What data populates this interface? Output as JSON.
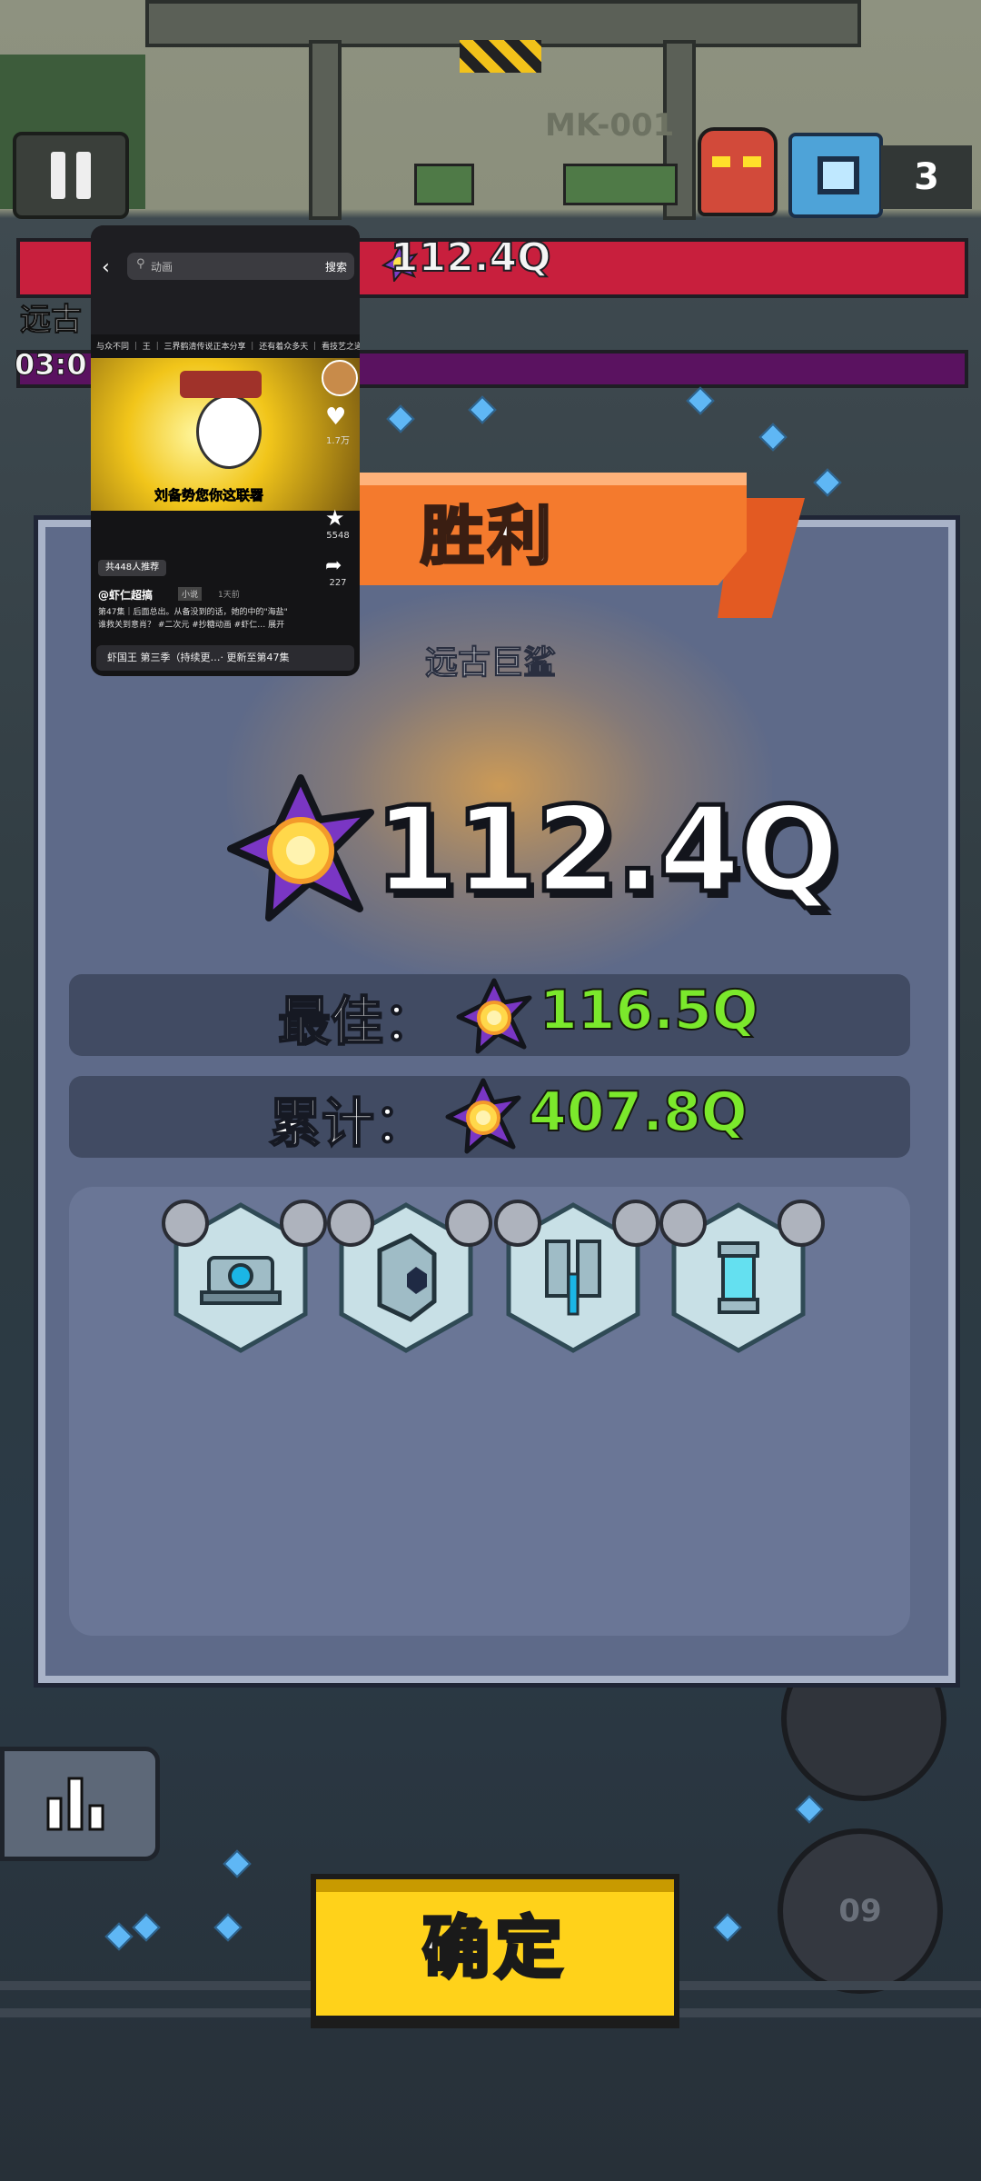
{
  "top_hud": {
    "boss_total_damage": "112.4Q",
    "boss_label_left": "远古",
    "timer_left": "03:0",
    "wall_code": "MK-001",
    "stage_count": "3"
  },
  "result_dialog": {
    "title": "胜利",
    "boss_name": "远古巨鲨",
    "damage_value": "112.4Q",
    "best_label": "最佳：",
    "best_value": "116.5Q",
    "total_label": "累计：",
    "total_value": "407.8Q",
    "equipment": [
      {
        "name": "turret-core",
        "badge_left": "crown-icon",
        "badge_right": "gear-icon"
      },
      {
        "name": "shield-plate",
        "badge_left": "shield-icon",
        "badge_right": "gear-icon"
      },
      {
        "name": "twin-barrel",
        "badge_left": "shield-icon",
        "badge_right": "gear-icon"
      },
      {
        "name": "energy-cell",
        "badge_left": "shield-icon",
        "badge_right": "gear-icon"
      }
    ],
    "confirm_label": "确定"
  },
  "bottom_right_badge": "09",
  "video_overlay": {
    "search_placeholder": "动画",
    "search_button": "搜索",
    "topic_strip": [
      "与众不同",
      "王",
      "三界鹤清传说正本分享",
      "还有着众多天",
      "看技艺之道分享!"
    ],
    "subtitle": "刘备势您你这联署",
    "like_count": "1.7万",
    "star_count": "5548",
    "share_count": "227",
    "recommend_label": "共448人推荐",
    "author": "@虾仁超搞",
    "tag": "小说",
    "time": "1天前",
    "desc_line1": "第47集｜后面总出。从备没到的话，她的中的\"海盐\"",
    "desc_line2": "谁救关到意肖？ #二次元 #抄糖动画 #虾仁… 展开",
    "bottom_bar": "虾国王 第三季（持续更…· 更新至第47集"
  },
  "colors": {
    "panel": "#5e6a89",
    "banner": "#f47a2d",
    "value_green": "#7be82c",
    "confirm_yellow": "#ffd21a",
    "boss_bar": "#c81f3d"
  }
}
